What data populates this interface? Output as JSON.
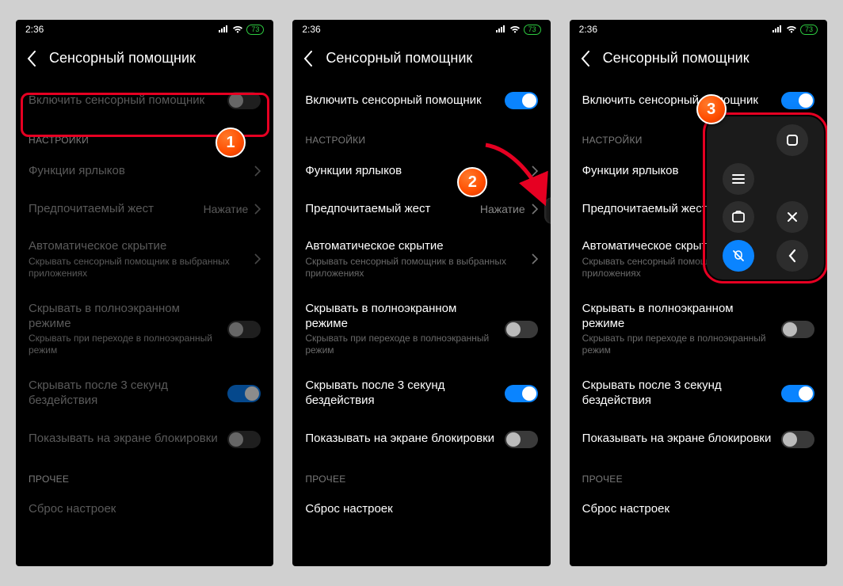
{
  "status": {
    "time": "2:36",
    "battery": "73"
  },
  "header": {
    "title": "Сенсорный помощник"
  },
  "sections": {
    "settings": "НАСТРОЙКИ",
    "other": "ПРОЧЕЕ"
  },
  "rows": {
    "enable": "Включить сенсорный помощник",
    "shortcuts": "Функции ярлыков",
    "gesture": "Предпочитаемый жест",
    "gesture_value": "Нажатие",
    "autohide": "Автоматическое скрытие",
    "autohide_sub": "Скрывать сенсорный помощник в выбранных приложениях",
    "fullscreen": "Скрывать в полноэкранном режиме",
    "fullscreen_sub": "Скрывать при переходе в полноэкранный режим",
    "idle": "Скрывать после 3 секунд бездействия",
    "lockscreen": "Показывать на экране блокировки",
    "reset": "Сброс настроек"
  },
  "badges": {
    "one": "1",
    "two": "2",
    "three": "3"
  }
}
